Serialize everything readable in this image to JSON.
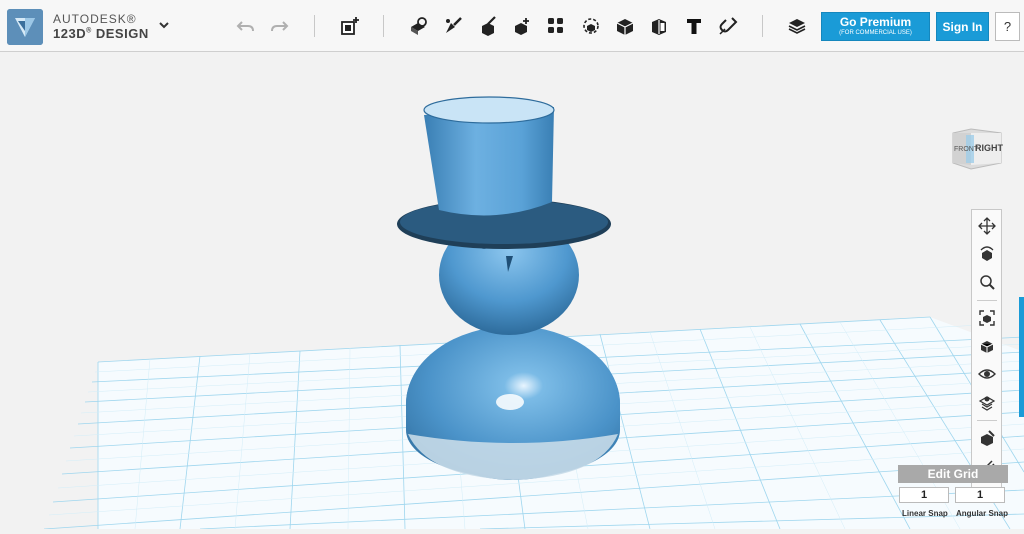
{
  "app": {
    "brand_line1": "AUTODESK®",
    "brand_line2": "123D",
    "brand_sup": "®",
    "brand_line3": " DESIGN"
  },
  "toolbar": {
    "undo_icon": "undo-icon",
    "redo_icon": "redo-icon",
    "tools": [
      "primitives",
      "sketch",
      "construct",
      "modify",
      "pattern",
      "grouping",
      "combine",
      "measure",
      "text",
      "snap"
    ],
    "premium_label": "Go Premium",
    "premium_sub": "(FOR COMMERCIAL USE)",
    "signin_label": "Sign In",
    "help_label": "?"
  },
  "viewcube": {
    "front": "FRONT",
    "right": "RIGHT"
  },
  "nav_tools": [
    "pan",
    "orbit",
    "zoom",
    "fit",
    "views",
    "visibility",
    "materials",
    "snap",
    "properties"
  ],
  "grid": {
    "edit_label": "Edit Grid",
    "linear_snap_value": "1",
    "linear_snap_label": "Linear Snap",
    "angular_snap_value": "1",
    "angular_snap_label": "Angular Snap"
  },
  "colors": {
    "accent": "#1a9bd7",
    "model": "#5aa3d6",
    "grid_line": "#8fd0ea"
  }
}
